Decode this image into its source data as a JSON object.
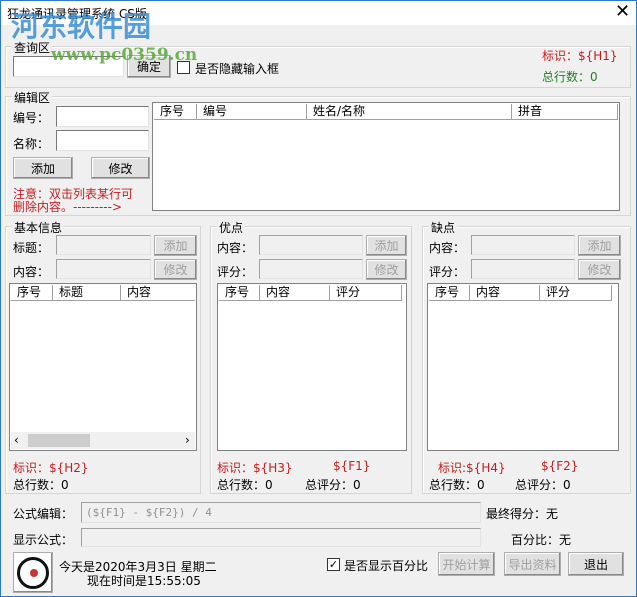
{
  "window": {
    "title": "狂龙通讯录管理系统 CS版",
    "close": "✕"
  },
  "watermark": {
    "name": "河东软件园",
    "url": "www.pc0359.cn"
  },
  "query": {
    "group": "查询区",
    "input_value": "",
    "confirm": "确定",
    "hide_checkbox": "是否隐藏输入框",
    "hide_checked": false,
    "tag": "标识：${H1}",
    "total": "总行数：0",
    "colors": {
      "tag": "#c81e1e",
      "total": "#208020"
    }
  },
  "edit": {
    "group": "编辑区",
    "id_label": "编号：",
    "name_label": "名称：",
    "add": "添加",
    "modify": "修改",
    "note1": "注意：双击列表某行可",
    "note2": "删除内容。--------->",
    "columns": [
      "序号",
      "编号",
      "姓名/名称",
      "拼音"
    ]
  },
  "basic": {
    "group": "基本信息",
    "title_label": "标题：",
    "content_label": "内容：",
    "add": "添加",
    "modify": "修改",
    "columns": [
      "序号",
      "标题",
      "内容"
    ],
    "tag": "标识：${H2}",
    "total": "总行数：0",
    "scroll_left": "‹",
    "scroll_right": "›"
  },
  "pros": {
    "group": "优点",
    "content_label": "内容：",
    "score_label": "评分：",
    "add": "添加",
    "modify": "修改",
    "columns": [
      "序号",
      "内容",
      "评分"
    ],
    "tag": "标识：${H3}",
    "var": "${F1}",
    "total": "总行数：0",
    "score_total": "总评分：0"
  },
  "cons": {
    "group": "缺点",
    "content_label": "内容：",
    "score_label": "评分：",
    "add": "添加",
    "modify": "修改",
    "columns": [
      "序号",
      "内容",
      "评分"
    ],
    "tag": "标识:${H4}",
    "var": "${F2}",
    "total": "总行数：0",
    "score_total": "总评分：0"
  },
  "formula": {
    "edit_label": "公式编辑：",
    "edit_value": "(${F1} - ${F2}) / 4",
    "show_label": "显示公式：",
    "show_value": "",
    "final_score": "最终得分：无",
    "percent": "百分比：无"
  },
  "footer": {
    "date": "今天是2020年3月3日 星期二",
    "time": "现在时间是15:55:05",
    "percent_checkbox": "是否显示百分比",
    "percent_checked": true,
    "start": "开始计算",
    "export": "导出资料",
    "exit": "退出"
  }
}
